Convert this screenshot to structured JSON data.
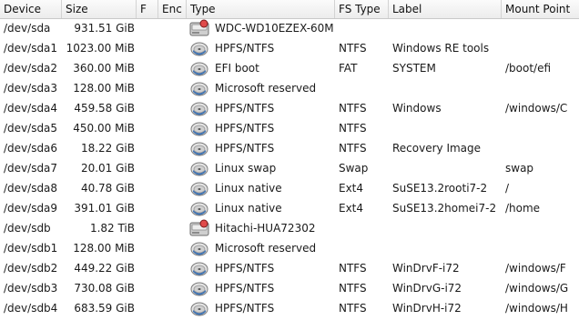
{
  "columns": {
    "device": "Device",
    "size": "Size",
    "flags": "F",
    "enc": "Enc",
    "type": "Type",
    "fstype": "FS Type",
    "label": "Label",
    "mount": "Mount Point"
  },
  "rows": [
    {
      "device": "/dev/sda",
      "size": "931.51 GiB",
      "icon": "hard-disk-icon",
      "type": "WDC-WD10EZEX-60M",
      "fstype": "",
      "label": "",
      "mount": ""
    },
    {
      "device": "/dev/sda1",
      "size": "1023.00 MiB",
      "icon": "partition-icon",
      "type": "HPFS/NTFS",
      "fstype": "NTFS",
      "label": "Windows RE tools",
      "mount": ""
    },
    {
      "device": "/dev/sda2",
      "size": "360.00 MiB",
      "icon": "partition-icon",
      "type": "EFI boot",
      "fstype": "FAT",
      "label": "SYSTEM",
      "mount": "/boot/efi"
    },
    {
      "device": "/dev/sda3",
      "size": "128.00 MiB",
      "icon": "partition-icon",
      "type": "Microsoft reserved",
      "fstype": "",
      "label": "",
      "mount": ""
    },
    {
      "device": "/dev/sda4",
      "size": "459.58 GiB",
      "icon": "partition-icon",
      "type": "HPFS/NTFS",
      "fstype": "NTFS",
      "label": "Windows",
      "mount": "/windows/C"
    },
    {
      "device": "/dev/sda5",
      "size": "450.00 MiB",
      "icon": "partition-icon",
      "type": "HPFS/NTFS",
      "fstype": "NTFS",
      "label": "",
      "mount": ""
    },
    {
      "device": "/dev/sda6",
      "size": "18.22 GiB",
      "icon": "partition-icon",
      "type": "HPFS/NTFS",
      "fstype": "NTFS",
      "label": "Recovery Image",
      "mount": ""
    },
    {
      "device": "/dev/sda7",
      "size": "20.01 GiB",
      "icon": "partition-icon",
      "type": "Linux swap",
      "fstype": "Swap",
      "label": "",
      "mount": "swap"
    },
    {
      "device": "/dev/sda8",
      "size": "40.78 GiB",
      "icon": "partition-icon",
      "type": "Linux native",
      "fstype": "Ext4",
      "label": "SuSE13.2rooti7-2",
      "mount": "/"
    },
    {
      "device": "/dev/sda9",
      "size": "391.01 GiB",
      "icon": "partition-icon",
      "type": "Linux native",
      "fstype": "Ext4",
      "label": "SuSE13.2homei7-2",
      "mount": "/home"
    },
    {
      "device": "/dev/sdb",
      "size": "1.82 TiB",
      "icon": "hard-disk-icon",
      "type": "Hitachi-HUA72302",
      "fstype": "",
      "label": "",
      "mount": ""
    },
    {
      "device": "/dev/sdb1",
      "size": "128.00 MiB",
      "icon": "partition-icon",
      "type": "Microsoft reserved",
      "fstype": "",
      "label": "",
      "mount": ""
    },
    {
      "device": "/dev/sdb2",
      "size": "449.22 GiB",
      "icon": "partition-icon",
      "type": "HPFS/NTFS",
      "fstype": "NTFS",
      "label": "WinDrvF-i72",
      "mount": "/windows/F"
    },
    {
      "device": "/dev/sdb3",
      "size": "730.08 GiB",
      "icon": "partition-icon",
      "type": "HPFS/NTFS",
      "fstype": "NTFS",
      "label": "WinDrvG-i72",
      "mount": "/windows/G"
    },
    {
      "device": "/dev/sdb4",
      "size": "683.59 GiB",
      "icon": "partition-icon",
      "type": "HPFS/NTFS",
      "fstype": "NTFS",
      "label": "WinDrvH-i72",
      "mount": "/windows/H"
    }
  ]
}
